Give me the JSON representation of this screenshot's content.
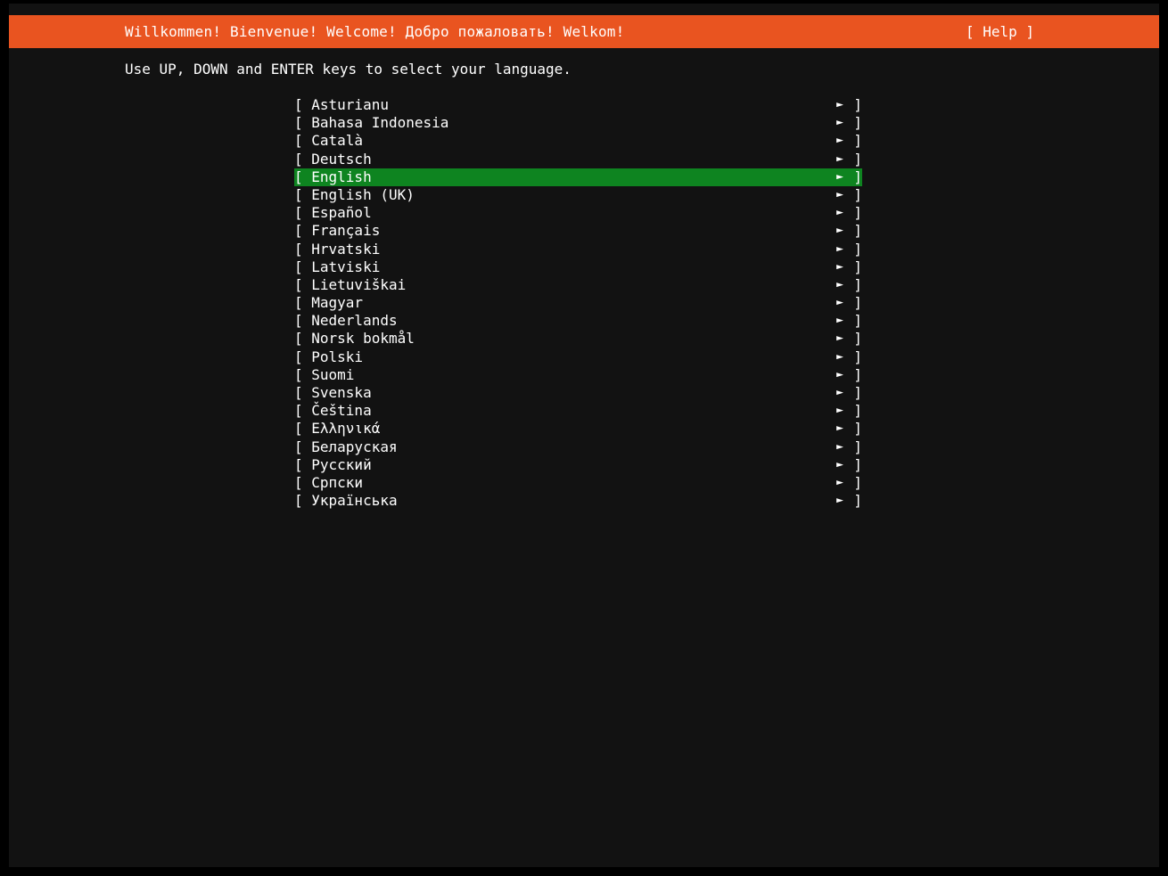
{
  "header": {
    "title": "Willkommen! Bienvenue! Welcome! Добро пожаловать! Welkom!",
    "help_label": "[ Help ]"
  },
  "instruction": "Use UP, DOWN and ENTER keys to select your language.",
  "language_list": {
    "selected": "English",
    "selected_index": 4,
    "left_bracket": "[",
    "right_bracket": "]",
    "arrow_glyph": "►",
    "items": [
      "Asturianu",
      "Bahasa Indonesia",
      "Català",
      "Deutsch",
      "English",
      "English (UK)",
      "Español",
      "Français",
      "Hrvatski",
      "Latviski",
      "Lietuviškai",
      "Magyar",
      "Nederlands",
      "Norsk bokmål",
      "Polski",
      "Suomi",
      "Svenska",
      "Čeština",
      "Ελληνικά",
      "Беларуская",
      "Русский",
      "Српски",
      "Українська"
    ]
  },
  "colors": {
    "outer_bg": "#000000",
    "screen_bg": "#121212",
    "header_bg": "#E95420",
    "selected_bg": "#0E8420",
    "text": "#FFFFFF"
  }
}
